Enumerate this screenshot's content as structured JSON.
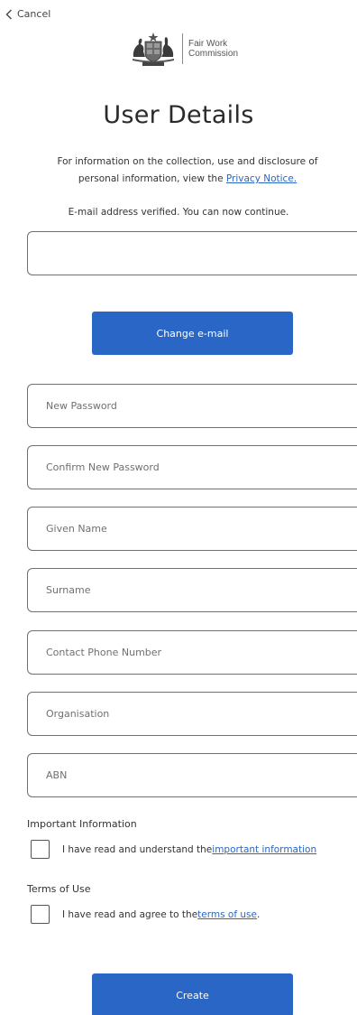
{
  "nav": {
    "cancel_label": "Cancel"
  },
  "logo": {
    "line1": "Fair Work",
    "line2": "Commission"
  },
  "page": {
    "title": "User Details",
    "info_line1": "For information on the collection, use and disclosure of",
    "info_line2_prefix": "personal information, view the ",
    "privacy_link": "Privacy Notice.",
    "verified_message": "E-mail address verified. You can now continue."
  },
  "email": {
    "value": ""
  },
  "buttons": {
    "change_email": "Change e-mail",
    "create": "Create"
  },
  "fields": {
    "new_password": "New Password",
    "confirm_password": "Confirm New Password",
    "given_name": "Given Name",
    "surname": "Surname",
    "phone": "Contact Phone Number",
    "organisation": "Organisation",
    "abn": "ABN"
  },
  "important": {
    "heading": "Important Information",
    "text": "I have read and understand the ",
    "link": "important information"
  },
  "terms": {
    "heading": "Terms of Use",
    "text": "I have read and agree to the ",
    "link": "terms of use",
    "suffix": "."
  },
  "colors": {
    "accent": "#2a66c5",
    "border": "#6f6f6f"
  }
}
